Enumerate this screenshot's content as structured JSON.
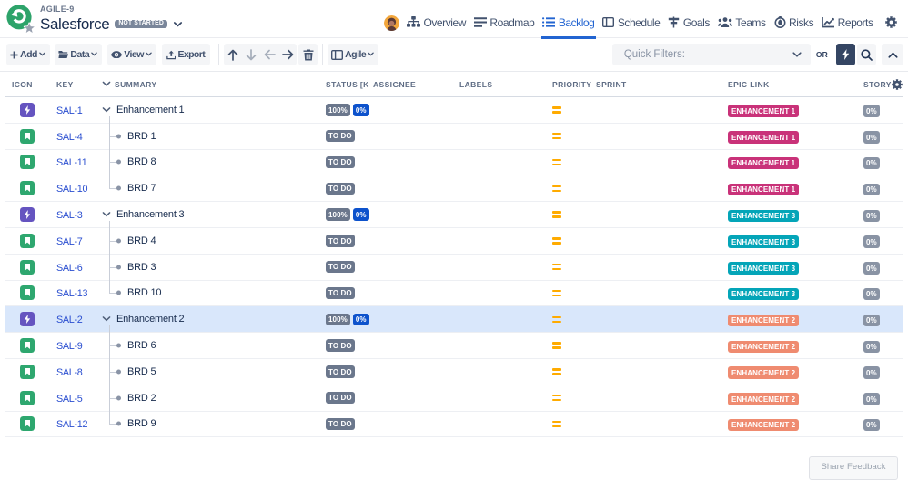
{
  "header": {
    "project_code": "AGILE-9",
    "title": "Salesforce",
    "status_badge": "NOT STARTED",
    "nav_items": [
      {
        "id": "overview",
        "label": "Overview",
        "icon": "sitemap-icon",
        "active": false
      },
      {
        "id": "roadmap",
        "label": "Roadmap",
        "icon": "bars-icon",
        "active": false
      },
      {
        "id": "backlog",
        "label": "Backlog",
        "icon": "list-icon",
        "active": true
      },
      {
        "id": "schedule",
        "label": "Schedule",
        "icon": "board-split-icon",
        "active": false
      },
      {
        "id": "goals",
        "label": "Goals",
        "icon": "signpost-icon",
        "active": false
      },
      {
        "id": "teams",
        "label": "Teams",
        "icon": "people-icon",
        "active": false
      },
      {
        "id": "risks",
        "label": "Risks",
        "icon": "flame-circle-icon",
        "active": false
      },
      {
        "id": "reports",
        "label": "Reports",
        "icon": "chart-icon",
        "active": false
      }
    ]
  },
  "toolbar": {
    "add_label": "Add",
    "data_label": "Data",
    "view_label": "View",
    "export_label": "Export",
    "agile_label": "Agile",
    "quick_filters_placeholder": "Quick Filters:",
    "or_label": "OR"
  },
  "table": {
    "columns": {
      "icon": "ICON",
      "key": "KEY",
      "summary": "SUMMARY",
      "status": "STATUS [K",
      "assignee": "ASSIGNEE",
      "labels": "LABELS",
      "priority": "PRIORITY",
      "sprint": "SPRINT",
      "epic_link": "EPIC LINK",
      "story": "STORY"
    },
    "rows": [
      {
        "key": "SAL-1",
        "summary": "Enhancement 1",
        "type": "epic",
        "tree": "parent",
        "badges": [
          {
            "text": "100%",
            "color": "gray"
          },
          {
            "text": "0%",
            "color": "blue"
          }
        ],
        "priority": "medium",
        "epic_link": "ENHANCEMENT 1",
        "epic_color": "pink",
        "story": "0%",
        "highlighted": false
      },
      {
        "key": "SAL-4",
        "summary": "BRD 1",
        "type": "story",
        "tree": "child",
        "badges": [
          {
            "text": "TO DO",
            "color": "gray"
          }
        ],
        "priority": "medium",
        "epic_link": "ENHANCEMENT 1",
        "epic_color": "pink",
        "story": "0%",
        "highlighted": false
      },
      {
        "key": "SAL-11",
        "summary": "BRD 8",
        "type": "story",
        "tree": "child",
        "badges": [
          {
            "text": "TO DO",
            "color": "gray"
          }
        ],
        "priority": "medium",
        "epic_link": "ENHANCEMENT 1",
        "epic_color": "pink",
        "story": "0%",
        "highlighted": false
      },
      {
        "key": "SAL-10",
        "summary": "BRD 7",
        "type": "story",
        "tree": "last",
        "badges": [
          {
            "text": "TO DO",
            "color": "gray"
          }
        ],
        "priority": "medium",
        "epic_link": "ENHANCEMENT 1",
        "epic_color": "pink",
        "story": "0%",
        "highlighted": false
      },
      {
        "key": "SAL-3",
        "summary": "Enhancement 3",
        "type": "epic",
        "tree": "parent",
        "badges": [
          {
            "text": "100%",
            "color": "gray"
          },
          {
            "text": "0%",
            "color": "blue"
          }
        ],
        "priority": "medium",
        "epic_link": "ENHANCEMENT 3",
        "epic_color": "teal",
        "story": "0%",
        "highlighted": false
      },
      {
        "key": "SAL-7",
        "summary": "BRD 4",
        "type": "story",
        "tree": "child",
        "badges": [
          {
            "text": "TO DO",
            "color": "gray"
          }
        ],
        "priority": "medium",
        "epic_link": "ENHANCEMENT 3",
        "epic_color": "teal",
        "story": "0%",
        "highlighted": false
      },
      {
        "key": "SAL-6",
        "summary": "BRD 3",
        "type": "story",
        "tree": "child",
        "badges": [
          {
            "text": "TO DO",
            "color": "gray"
          }
        ],
        "priority": "medium",
        "epic_link": "ENHANCEMENT 3",
        "epic_color": "teal",
        "story": "0%",
        "highlighted": false
      },
      {
        "key": "SAL-13",
        "summary": "BRD 10",
        "type": "story",
        "tree": "last",
        "badges": [
          {
            "text": "TO DO",
            "color": "gray"
          }
        ],
        "priority": "medium",
        "epic_link": "ENHANCEMENT 3",
        "epic_color": "teal",
        "story": "0%",
        "highlighted": false
      },
      {
        "key": "SAL-2",
        "summary": "Enhancement 2",
        "type": "epic",
        "tree": "parent",
        "badges": [
          {
            "text": "100%",
            "color": "gray"
          },
          {
            "text": "0%",
            "color": "blue"
          }
        ],
        "priority": "medium",
        "epic_link": "ENHANCEMENT 2",
        "epic_color": "salmon",
        "story": "0%",
        "highlighted": true
      },
      {
        "key": "SAL-9",
        "summary": "BRD 6",
        "type": "story",
        "tree": "child",
        "badges": [
          {
            "text": "TO DO",
            "color": "gray"
          }
        ],
        "priority": "medium",
        "epic_link": "ENHANCEMENT 2",
        "epic_color": "salmon",
        "story": "0%",
        "highlighted": false
      },
      {
        "key": "SAL-8",
        "summary": "BRD 5",
        "type": "story",
        "tree": "child",
        "badges": [
          {
            "text": "TO DO",
            "color": "gray"
          }
        ],
        "priority": "medium",
        "epic_link": "ENHANCEMENT 2",
        "epic_color": "salmon",
        "story": "0%",
        "highlighted": false
      },
      {
        "key": "SAL-5",
        "summary": "BRD 2",
        "type": "story",
        "tree": "child",
        "badges": [
          {
            "text": "TO DO",
            "color": "gray"
          }
        ],
        "priority": "medium",
        "epic_link": "ENHANCEMENT 2",
        "epic_color": "salmon",
        "story": "0%",
        "highlighted": false
      },
      {
        "key": "SAL-12",
        "summary": "BRD 9",
        "type": "story",
        "tree": "last",
        "badges": [
          {
            "text": "TO DO",
            "color": "gray"
          }
        ],
        "priority": "medium",
        "epic_link": "ENHANCEMENT 2",
        "epic_color": "salmon",
        "story": "0%",
        "highlighted": false
      }
    ]
  },
  "footer": {
    "share_feedback_label": "Share Feedback"
  },
  "colors": {
    "epic_pink": "#C93279",
    "epic_teal": "#04A5B8",
    "epic_salmon": "#EF8B70",
    "badge_gray": "#6B778C",
    "badge_blue": "#0D52CC",
    "story_badge_gray": "#8993A4",
    "priority_orange": "#FFAB00",
    "highlight_row": "#D9E7FB",
    "nav_active_blue": "#2264D1",
    "key_link_blue": "#2B4FD0",
    "epic_icon_purple": "#6554C0",
    "story_icon_green": "#2EA76F",
    "logo_green": "#2DA36A"
  }
}
